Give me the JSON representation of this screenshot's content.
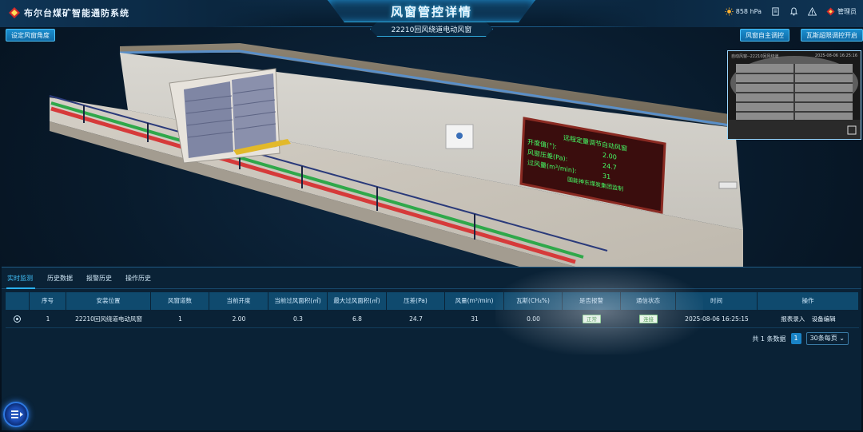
{
  "header": {
    "system_title": "布尔台煤矿智能通防系统",
    "page_title": "风窗管控详情",
    "subtitle": "22210回风绕道电动风窗",
    "pressure": "858 hPa",
    "user": "管理员"
  },
  "toolbar": {
    "set_angle": "设定风窗角度",
    "auto_control": "风窗自主调控",
    "gas_control": "瓦斯超限调控开启"
  },
  "scene": {
    "board_title": "远程定量调节自动风窗",
    "board_rows": [
      {
        "label": "开度值(°):",
        "value": "2.00"
      },
      {
        "label": "风窗压差(Pa):",
        "value": "24.7"
      },
      {
        "label": "过风量(m³/min):",
        "value": "31"
      }
    ],
    "board_footer": "国能神东煤炭集团监制",
    "camera_label": "自动风窗--22210回风绕道",
    "camera_time": "2025-08-06 16:25:16"
  },
  "tabs": [
    "实时监测",
    "历史数据",
    "报警历史",
    "操作历史"
  ],
  "table": {
    "headers": [
      "序号",
      "安装位置",
      "风窗道数",
      "当前开度",
      "当前过风面积(㎡)",
      "最大过风面积(㎡)",
      "压差(Pa)",
      "风量(m³/min)",
      "瓦斯(CH₄%)",
      "是否报警",
      "通信状态",
      "时间",
      "操作"
    ],
    "rows": [
      {
        "index": "1",
        "location": "22210回风绕道电动风窗",
        "count": "1",
        "opening": "2.00",
        "current_area": "0.3",
        "max_area": "6.8",
        "pressure": "24.7",
        "airflow": "31",
        "gas": "0.00",
        "alarm": "正常",
        "comm": "连接",
        "time": "2025-08-06 16:25:15",
        "action_report": "报表录入",
        "action_edit": "设备编辑"
      }
    ]
  },
  "pagination": {
    "total": "共 1 条数据",
    "page": "1",
    "page_size": "30条每页"
  },
  "colors": {
    "accent": "#2ab1ef",
    "header_cell": "#0f4a6e",
    "status_ok": "#2d8b2d"
  }
}
